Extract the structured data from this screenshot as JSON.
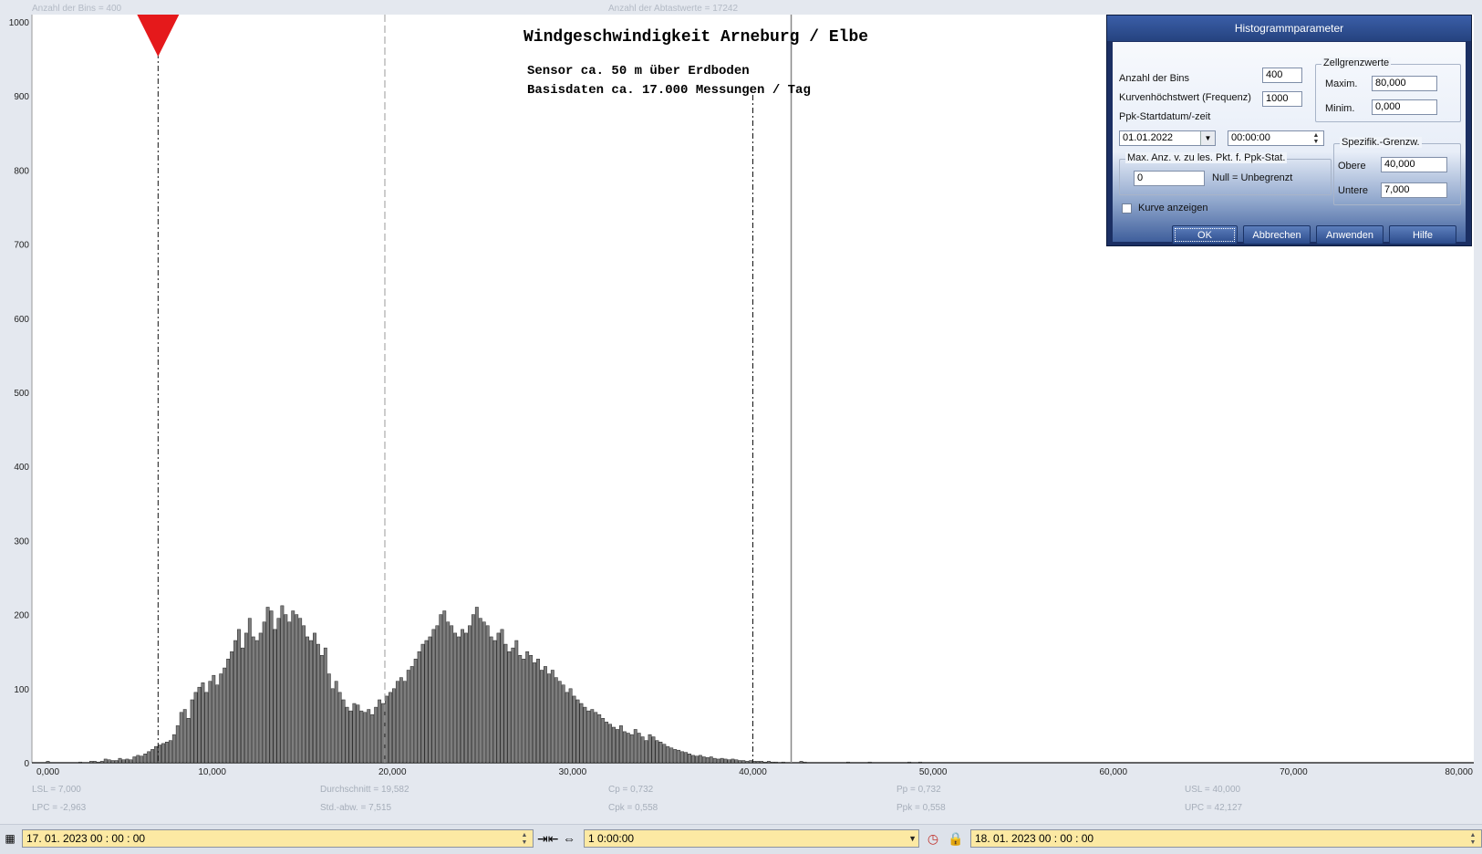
{
  "chart_data": {
    "type": "bar",
    "title": "Windgeschwindigkeit  Arneburg / Elbe",
    "subtitle_lines": [
      "Sensor ca. 50 m über Erdboden",
      "Basisdaten ca. 17.000 Messungen / Tag"
    ],
    "xlim": [
      0,
      80
    ],
    "ylim": [
      0,
      1000
    ],
    "x_tick_labels": [
      "0,000",
      "10,000",
      "20,000",
      "30,000",
      "40,000",
      "50,000",
      "60,000",
      "70,000",
      "80,000"
    ],
    "y_tick_labels": [
      "0",
      "100",
      "200",
      "300",
      "400",
      "500",
      "600",
      "700",
      "800",
      "900",
      "1000"
    ],
    "bin_width": 0.2,
    "bin_start": 0.8,
    "values": [
      2,
      0,
      0,
      0,
      0,
      0,
      0,
      0,
      0,
      1,
      0,
      0,
      2,
      2,
      1,
      2,
      5,
      4,
      3,
      3,
      6,
      4,
      5,
      4,
      8,
      10,
      9,
      12,
      15,
      18,
      22,
      24,
      26,
      28,
      30,
      38,
      50,
      68,
      72,
      60,
      85,
      95,
      102,
      108,
      95,
      110,
      118,
      105,
      120,
      128,
      140,
      150,
      165,
      180,
      155,
      175,
      195,
      170,
      165,
      175,
      190,
      210,
      205,
      180,
      195,
      212,
      200,
      190,
      205,
      200,
      195,
      185,
      170,
      165,
      175,
      160,
      145,
      155,
      120,
      100,
      110,
      95,
      85,
      75,
      70,
      80,
      78,
      70,
      68,
      72,
      65,
      75,
      85,
      80,
      90,
      95,
      100,
      110,
      115,
      110,
      125,
      130,
      140,
      150,
      160,
      165,
      170,
      180,
      185,
      200,
      205,
      190,
      185,
      175,
      170,
      180,
      175,
      185,
      200,
      210,
      195,
      190,
      185,
      170,
      165,
      175,
      180,
      160,
      150,
      155,
      165,
      145,
      140,
      150,
      145,
      135,
      140,
      125,
      130,
      120,
      125,
      115,
      110,
      105,
      95,
      100,
      90,
      85,
      80,
      75,
      70,
      72,
      68,
      65,
      60,
      55,
      52,
      48,
      45,
      50,
      42,
      40,
      38,
      45,
      40,
      35,
      30,
      38,
      35,
      30,
      28,
      25,
      22,
      20,
      18,
      17,
      15,
      14,
      12,
      10,
      9,
      10,
      8,
      7,
      8,
      6,
      5,
      6,
      5,
      4,
      5,
      4,
      3,
      3,
      2,
      3,
      2,
      2,
      2,
      1,
      2,
      1,
      1,
      0,
      1,
      0,
      0,
      0,
      0,
      2,
      1,
      0,
      0,
      0,
      0,
      0,
      0,
      0,
      0,
      0,
      0,
      0,
      1,
      0,
      0,
      0,
      0,
      0,
      1,
      0,
      0,
      0,
      0,
      0,
      0,
      0,
      0,
      0,
      0,
      1,
      0,
      0,
      1
    ],
    "reference_lines": [
      {
        "name": "LSL",
        "x": 7.0,
        "style": "dash-dot"
      },
      {
        "name": "Durchschnitt",
        "x": 19.582,
        "style": "dashed-light"
      },
      {
        "name": "USL",
        "x": 40.0,
        "style": "dash-dot"
      },
      {
        "name": "UPC",
        "x": 42.127,
        "style": "solid-gray"
      }
    ]
  },
  "header": {
    "bins_label": "Anzahl der Bins =   400",
    "samples_label": "Anzahl der Abtastwerte = 17242"
  },
  "stats": {
    "lsl": "LSL = 7,000",
    "lpc": "LPC = -2,963",
    "mean": "Durchschnitt  = 19,582",
    "stddev": "Std.-abw. = 7,515",
    "cp": "Cp  = 0,732",
    "cpk": "Cpk = 0,558",
    "pp": "Pp  = 0,732",
    "ppk": "Ppk = 0,558",
    "usl": "USL = 40,000",
    "upc": "UPC = 42,127"
  },
  "colors": {
    "bar_fill": "#7d7d7d",
    "marker": "#e5191b",
    "stat_text": "#a6aeba"
  },
  "dialog": {
    "title": "Histogrammparameter",
    "bins_label": "Anzahl der Bins",
    "bins_value": "400",
    "freq_label": "Kurvenhöchstwert (Frequenz)",
    "freq_value": "1000",
    "ppk_start_label": "Ppk-Startdatum/-zeit",
    "date_value": "01.01.2022",
    "time_value": "00:00:00",
    "max_group_label": "Max. Anz. v. zu les. Pkt. f. Ppk-Stat.",
    "max_value": "0",
    "null_label": "Null = Unbegrenzt",
    "show_curve_label": "Kurve anzeigen",
    "cell_limits_label": "Zellgrenzwerte",
    "maxim_label": "Maxim.",
    "maxim_value": "80,000",
    "minim_label": "Minim.",
    "minim_value": "0,000",
    "spec_label": "Spezifik.-Grenzw.",
    "upper_label": "Obere",
    "upper_value": "40,000",
    "lower_label": "Untere",
    "lower_value": "7,000",
    "ok": "OK",
    "cancel": "Abbrechen",
    "apply": "Anwenden",
    "help": "Hilfe"
  },
  "bottom": {
    "start_datetime": "17. 01. 2023    00 : 00 : 00",
    "span": "1 0:00:00",
    "end_datetime": "18. 01. 2023    00 : 00 : 00"
  }
}
